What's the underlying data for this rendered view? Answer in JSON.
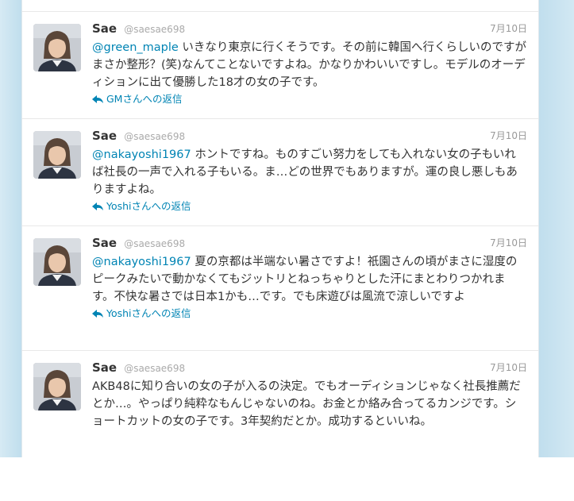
{
  "tweets": [
    {
      "name": "Sae",
      "screen_name": "@saesae698",
      "date": "7月10日",
      "mention": "@green_maple",
      "text": " いきなり東京に行くそうです。その前に韓国へ行くらしいのですがまさか整形？(笑)なんてことないですよね。かなりかわいいですし。モデルのオーディションに出て優勝した18才の女の子です。",
      "reply_label": "GMさんへの返信"
    },
    {
      "name": "Sae",
      "screen_name": "@saesae698",
      "date": "7月10日",
      "mention": "@nakayoshi1967",
      "text": " ホントですね。ものすごい努力をしても入れない女の子もいれば社長の一声で入れる子もいる。ま…どの世界でもありますが。運の良し悪しもありますよね。",
      "reply_label": "Yoshiさんへの返信"
    },
    {
      "name": "Sae",
      "screen_name": "@saesae698",
      "date": "7月10日",
      "mention": "@nakayoshi1967",
      "text": " 夏の京都は半端ない暑さですよ！祇園さんの頃がまさに湿度のピークみたいで動かなくてもジットリとねっちゃりとした汗にまとわりつかれます。不快な暑さでは日本1かも…です。でも床遊びは風流で涼しいですよ",
      "reply_label": "Yoshiさんへの返信"
    },
    {
      "name": "Sae",
      "screen_name": "@saesae698",
      "date": "7月10日",
      "mention": "",
      "text": "AKB48に知り合いの女の子が入るの決定。でもオーディションじゃなく社長推薦だとか…。やっぱり純粋なもんじゃないのね。お金とか絡み合ってるカンジです。ショートカットの女の子です。3年契約だとか。成功するといいね。",
      "reply_label": ""
    }
  ],
  "colors": {
    "link": "#0084b4",
    "background": "#c0deed",
    "text": "#333333"
  }
}
